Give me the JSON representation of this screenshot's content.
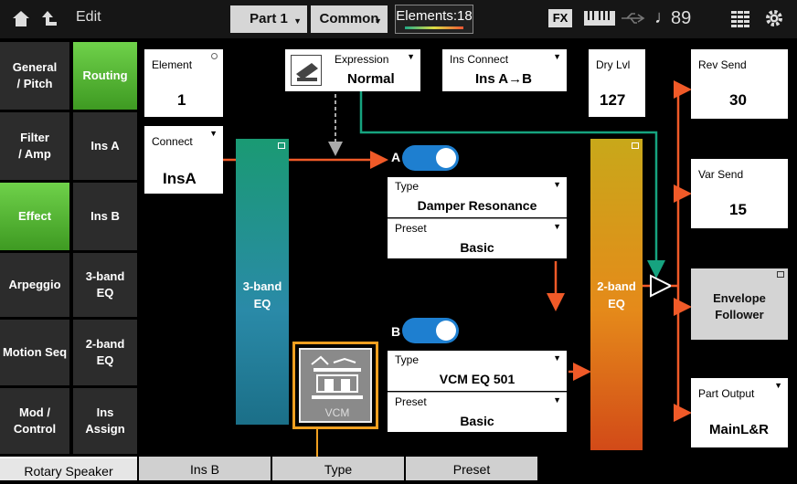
{
  "header": {
    "title": "Edit",
    "part_label": "Part 1",
    "common_label": "Common",
    "elements_label": "Elements:18",
    "fx_label": "FX",
    "tempo": "89",
    "icons": [
      "home-icon",
      "back-arrow-icon",
      "keyboard-icon",
      "usb-icon",
      "note-icon",
      "grid-icon",
      "gear-icon"
    ]
  },
  "left_tabs": [
    {
      "label": "General\n/ Pitch"
    },
    {
      "label": "Filter\n/ Amp"
    },
    {
      "label": "Effect"
    },
    {
      "label": "Arpeggio"
    },
    {
      "label": "Motion Seq"
    },
    {
      "label": "Mod /\nControl"
    }
  ],
  "sub_tabs": [
    {
      "label": "Routing"
    },
    {
      "label": "Ins A"
    },
    {
      "label": "Ins B"
    },
    {
      "label": "3-band\nEQ"
    },
    {
      "label": "2-band\nEQ"
    },
    {
      "label": "Ins\nAssign"
    }
  ],
  "element": {
    "label": "Element",
    "value": "1"
  },
  "connect": {
    "label": "Connect",
    "value": "InsA"
  },
  "expression": {
    "label": "Expression",
    "value": "Normal"
  },
  "ins_connect": {
    "label": "Ins Connect",
    "value": "Ins A→B"
  },
  "dry_lvl": {
    "label": "Dry Lvl",
    "value": "127"
  },
  "rev_send": {
    "label": "Rev Send",
    "value": "30"
  },
  "var_send": {
    "label": "Var Send",
    "value": "15"
  },
  "envelope_follower": {
    "label": "Envelope\nFollower"
  },
  "part_output": {
    "label": "Part Output",
    "value": "MainL&R"
  },
  "eq3": {
    "label": "3-band\nEQ"
  },
  "eq2": {
    "label": "2-band\nEQ"
  },
  "ins_a": {
    "switch_label": "A",
    "on": true,
    "type_label": "Type",
    "type_value": "Damper Resonance",
    "preset_label": "Preset",
    "preset_value": "Basic"
  },
  "ins_b": {
    "switch_label": "B",
    "on": true,
    "type_label": "Type",
    "type_value": "VCM EQ 501",
    "preset_label": "Preset",
    "preset_value": "Basic"
  },
  "vcm_label": "VCM",
  "bottom_tabs": [
    "Rotary Speaker",
    "Ins B",
    "Type",
    "Preset"
  ],
  "colors": {
    "accent_green": "#5fc83a",
    "route_orange": "#f05a28",
    "route_teal": "#16a37f",
    "toggle_blue": "#1e7fd0"
  }
}
